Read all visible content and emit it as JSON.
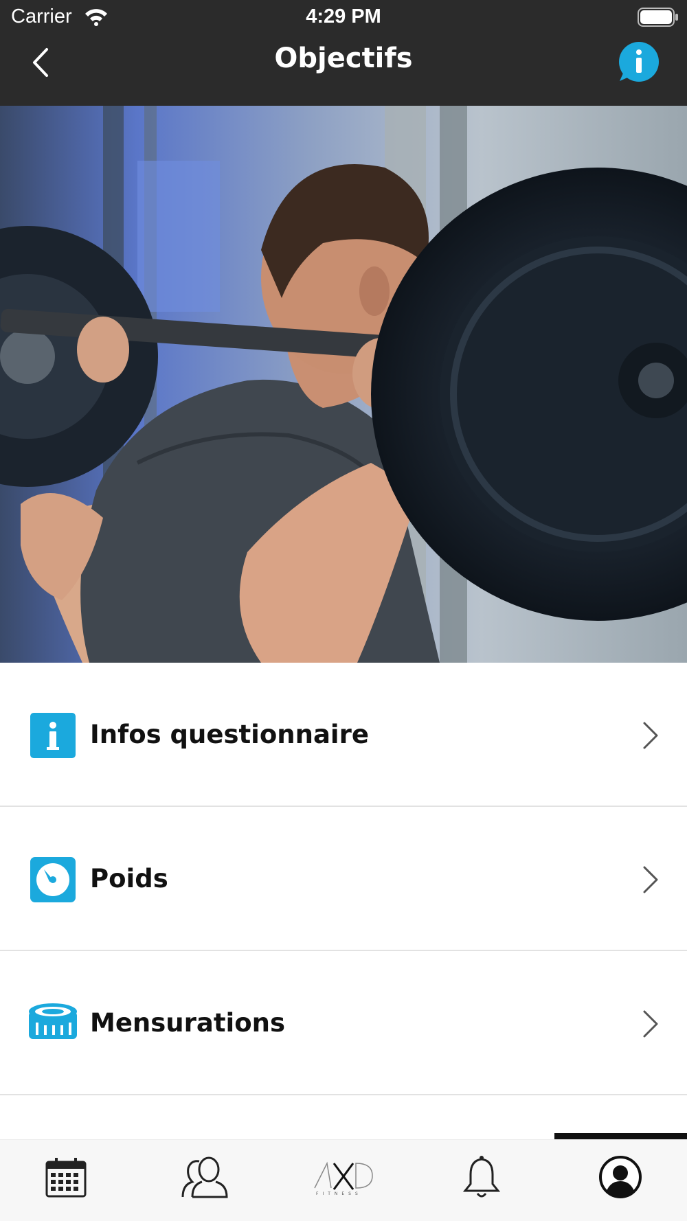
{
  "status_bar": {
    "carrier": "Carrier",
    "time": "4:29 PM",
    "wifi_icon": "wifi-icon",
    "battery_icon": "battery-icon"
  },
  "nav": {
    "title": "Objectifs",
    "back_icon": "chevron-left-icon",
    "info_icon": "info-bubble-icon"
  },
  "hero": {
    "image": "man-squatting-barbell-in-gym"
  },
  "menu": {
    "items": [
      {
        "label": "Infos questionnaire",
        "icon": "info-square-icon"
      },
      {
        "label": "Poids",
        "icon": "scale-icon"
      },
      {
        "label": "Mensurations",
        "icon": "measuring-tape-icon"
      }
    ]
  },
  "tabbar": {
    "items": [
      {
        "icon": "calendar-icon"
      },
      {
        "icon": "group-icon"
      },
      {
        "icon": "axd-fitness-logo",
        "logo_text": "AXD FITNESS"
      },
      {
        "icon": "bell-icon"
      },
      {
        "icon": "profile-icon",
        "selected": true
      }
    ]
  },
  "colors": {
    "header_bg": "#2b2b2b",
    "accent": "#1ba9dd",
    "text": "#111111",
    "divider": "#e2e2e2"
  }
}
